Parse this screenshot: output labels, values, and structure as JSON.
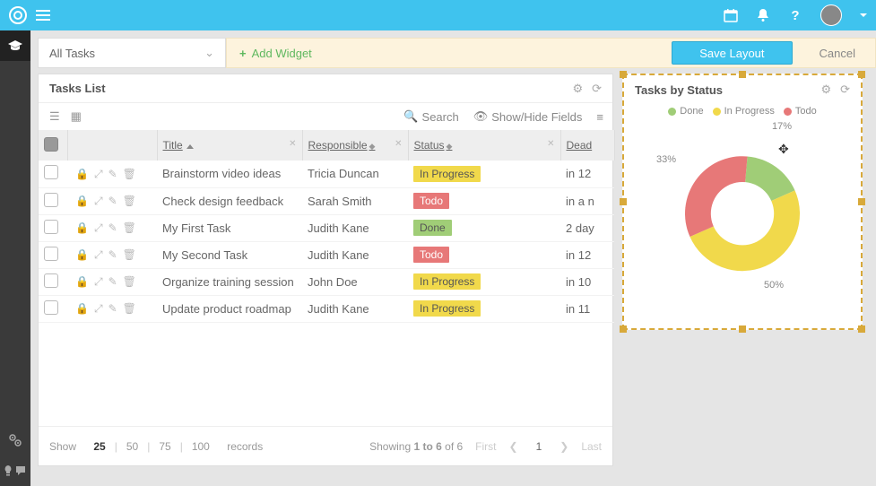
{
  "header": {
    "help": "?"
  },
  "rail": {
    "top_icon": "graduation-cap-icon",
    "bottom": [
      "gears-icon",
      "lightbulb-icon",
      "comment-icon"
    ]
  },
  "toolbar": {
    "filter_label": "All Tasks",
    "add_widget": "Add Widget",
    "save": "Save Layout",
    "cancel": "Cancel"
  },
  "tasks_panel": {
    "title": "Tasks List",
    "search": "Search",
    "showhide": "Show/Hide Fields",
    "columns": {
      "title": "Title",
      "responsible": "Responsible",
      "status": "Status",
      "deadline": "Dead"
    },
    "rows": [
      {
        "title": "Brainstorm video ideas",
        "responsible": "Tricia Duncan",
        "status": "In Progress",
        "status_class": "prog",
        "deadline": "in 12"
      },
      {
        "title": "Check design feedback",
        "responsible": "Sarah Smith",
        "status": "Todo",
        "status_class": "todo",
        "deadline": "in a n"
      },
      {
        "title": "My First Task",
        "responsible": "Judith Kane",
        "status": "Done",
        "status_class": "done",
        "deadline": "2 day"
      },
      {
        "title": "My Second Task",
        "responsible": "Judith Kane",
        "status": "Todo",
        "status_class": "todo",
        "deadline": "in 12"
      },
      {
        "title": "Organize training session",
        "responsible": "John Doe",
        "status": "In Progress",
        "status_class": "prog",
        "deadline": "in 10"
      },
      {
        "title": "Update product roadmap",
        "responsible": "Judith Kane",
        "status": "In Progress",
        "status_class": "prog",
        "deadline": "in 11"
      }
    ],
    "footer": {
      "show": "Show",
      "sizes": [
        "25",
        "50",
        "75",
        "100"
      ],
      "active_size": "25",
      "records": "records",
      "showing": "Showing <b>1 to 6</b> of 6",
      "first": "First",
      "last": "Last",
      "page": "1"
    }
  },
  "status_panel": {
    "title": "Tasks by Status",
    "legend": [
      {
        "label": "Done",
        "color": "#a0cd77"
      },
      {
        "label": "In Progress",
        "color": "#f1d94b"
      },
      {
        "label": "Todo",
        "color": "#e77878"
      }
    ]
  },
  "chart_data": {
    "type": "pie",
    "title": "Tasks by Status",
    "series": [
      {
        "name": "Done",
        "value": 17,
        "color": "#a0cd77"
      },
      {
        "name": "In Progress",
        "value": 50,
        "color": "#f1d94b"
      },
      {
        "name": "Todo",
        "value": 33,
        "color": "#e77878"
      }
    ],
    "labels": {
      "done": "17%",
      "prog": "50%",
      "todo": "33%"
    }
  }
}
